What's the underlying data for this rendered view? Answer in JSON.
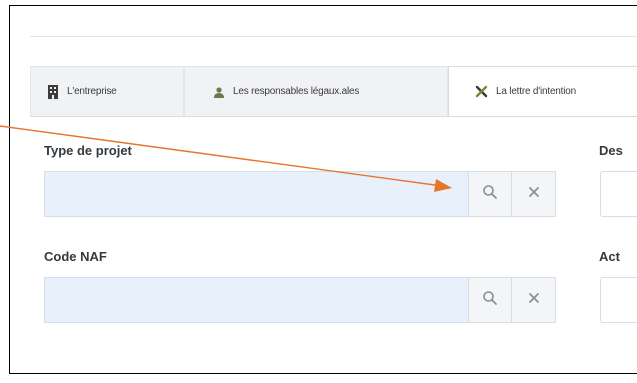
{
  "tabs": [
    {
      "label": "L'entreprise",
      "icon": "building-icon",
      "active": false
    },
    {
      "label": "Les responsables légaux.ales",
      "icon": "user-icon",
      "active": false
    },
    {
      "label": "La lettre d'intention",
      "icon": "tools-icon",
      "active": true
    }
  ],
  "fields": {
    "type_projet": {
      "label": "Type de projet",
      "value": ""
    },
    "code_naf": {
      "label": "Code NAF",
      "value": ""
    }
  },
  "right_column": {
    "label_1": "Des",
    "label_2": "Act"
  },
  "annotation": {
    "arrow_color": "#e8742c"
  },
  "colors": {
    "input_fill": "#e8f1fb",
    "border": "#d5dde6",
    "icon": "#8a9096"
  }
}
